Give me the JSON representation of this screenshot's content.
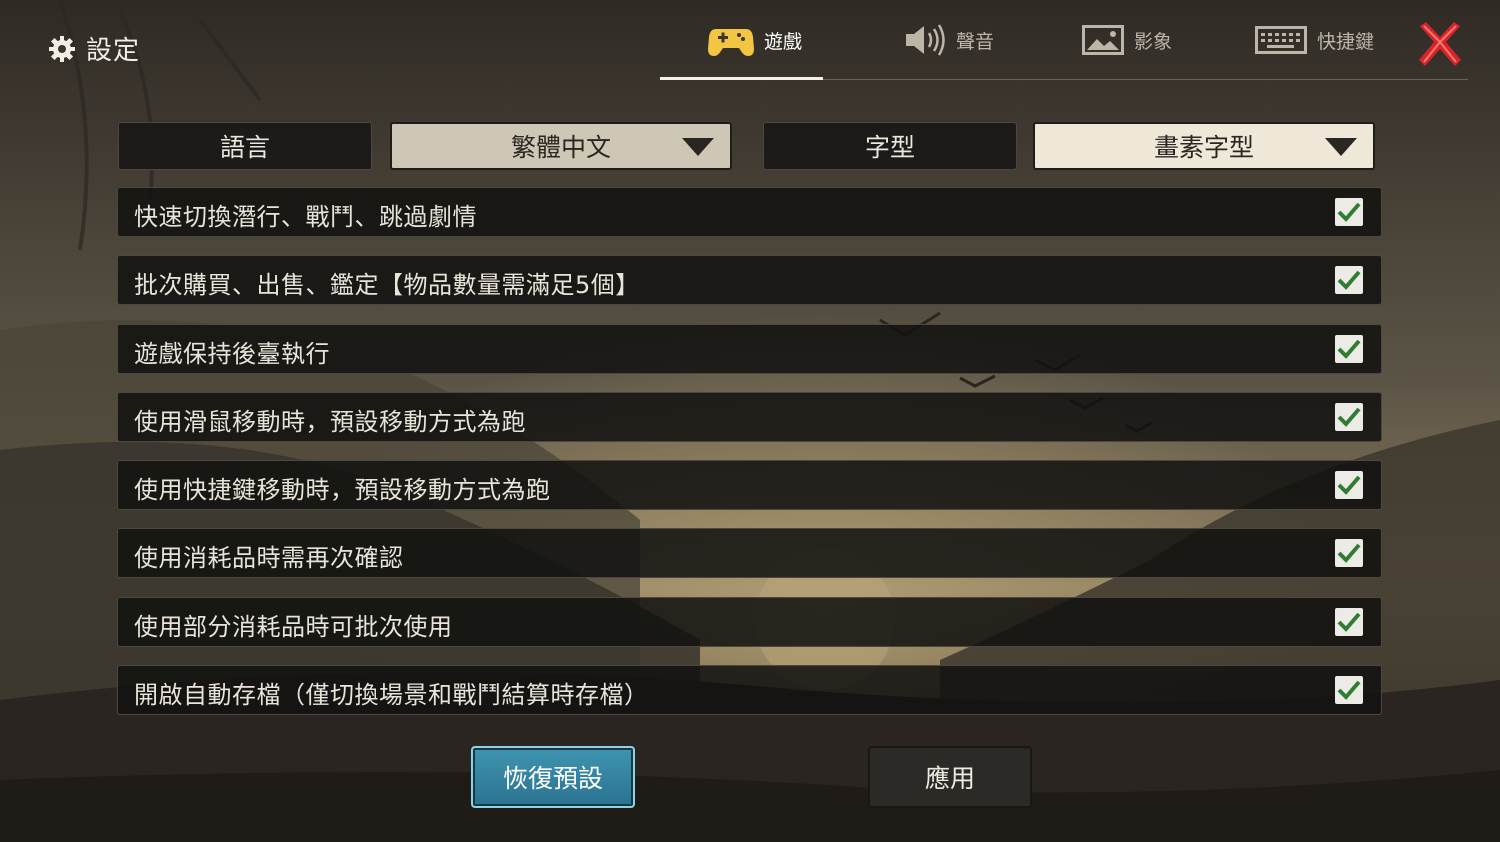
{
  "window": {
    "title": "設定"
  },
  "tabs": [
    {
      "label": "遊戲",
      "icon": "gamepad-icon",
      "active": true
    },
    {
      "label": "聲音",
      "icon": "speaker-icon",
      "active": false
    },
    {
      "label": "影象",
      "icon": "image-icon",
      "active": false
    },
    {
      "label": "快捷鍵",
      "icon": "keyboard-icon",
      "active": false
    }
  ],
  "selectors": {
    "language_label": "語言",
    "language_value": "繁體中文",
    "font_label": "字型",
    "font_value": "畫素字型"
  },
  "options": [
    {
      "label": "快速切換潛行、戰鬥、跳過劇情",
      "checked": true
    },
    {
      "label": "批次購買、出售、鑑定【物品數量需滿足5個】",
      "checked": true
    },
    {
      "label": "遊戲保持後臺執行",
      "checked": true
    },
    {
      "label": "使用滑鼠移動時，預設移動方式為跑",
      "checked": true
    },
    {
      "label": "使用快捷鍵移動時，預設移動方式為跑",
      "checked": true
    },
    {
      "label": "使用消耗品時需再次確認",
      "checked": true
    },
    {
      "label": "使用部分消耗品時可批次使用",
      "checked": true
    },
    {
      "label": "開啟自動存檔（僅切換場景和戰鬥結算時存檔）",
      "checked": true
    }
  ],
  "buttons": {
    "reset_label": "恢復預設",
    "apply_label": "應用"
  },
  "colors": {
    "accent_blue": "#2f85a3",
    "check_green": "#2e7d32",
    "close_red": "#d8232a",
    "tab_gamepad": "#f2c542"
  }
}
